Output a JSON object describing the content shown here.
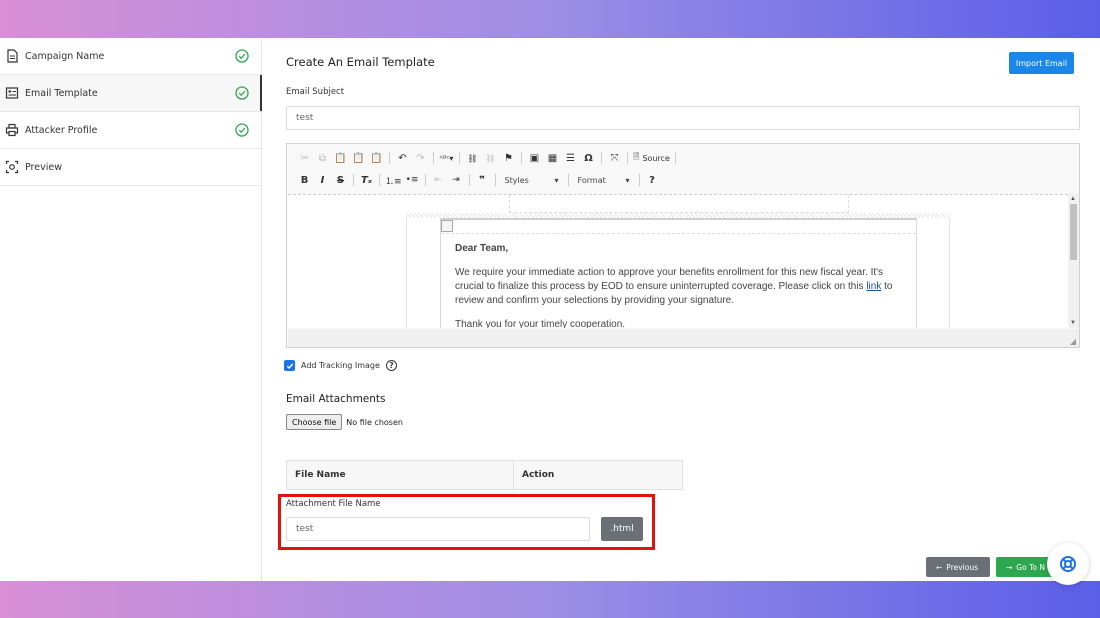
{
  "sidebar": {
    "items": [
      {
        "label": "Campaign Name",
        "done": true
      },
      {
        "label": "Email Template",
        "done": true
      },
      {
        "label": "Attacker Profile",
        "done": true
      },
      {
        "label": "Preview",
        "done": false
      }
    ],
    "active_index": 1
  },
  "main": {
    "title": "Create An Email Template",
    "import_button": "Import Email",
    "subject_label": "Email Subject",
    "subject_value": "test"
  },
  "editor": {
    "toolbar_row1": [
      "cut",
      "copy",
      "paste",
      "paste-text",
      "paste-word",
      "undo",
      "redo",
      "spellcheck",
      "link",
      "unlink",
      "anchor",
      "image",
      "table",
      "horizontal-line",
      "special-char",
      "maximize",
      "source"
    ],
    "source_label": "Source",
    "styles_label": "Styles",
    "format_label": "Format",
    "help_label": "?",
    "body": {
      "greeting": "Dear Team,",
      "paragraph1_before_link": "We require your immediate action to approve your benefits enrollment for this new fiscal year. It's crucial to finalize this process by EOD to ensure uninterrupted coverage. Please click on this",
      "link_text": "link",
      "paragraph1_after_link": "to review and confirm your selections by providing your signature.",
      "paragraph2": "Thank you for your timely cooperation."
    }
  },
  "tracking": {
    "label": "Add Tracking Image",
    "checked": true,
    "help": "?"
  },
  "attachments": {
    "title": "Email Attachments",
    "choose_button": "Choose file",
    "no_file": "No file chosen",
    "columns": [
      "File Name",
      "Action"
    ],
    "file_name_label": "Attachment File Name",
    "file_name_value": "test",
    "extension": ".html"
  },
  "nav": {
    "previous": "Previous",
    "next": "Go To N"
  },
  "colors": {
    "primary": "#1a86e8",
    "success": "#2ea84f",
    "secondary": "#6b7077",
    "highlight": "#e3120b"
  }
}
